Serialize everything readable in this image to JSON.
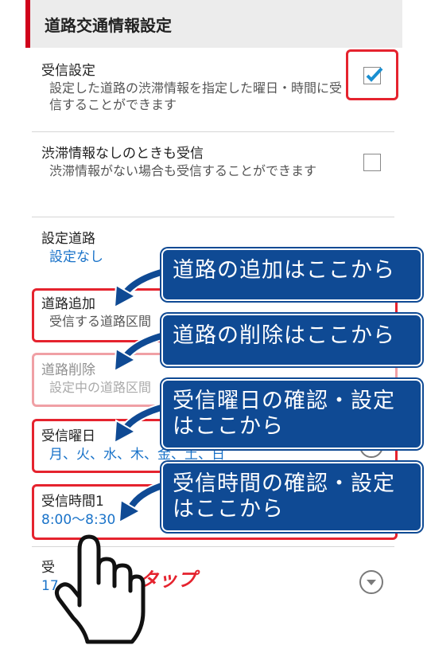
{
  "header": {
    "title": "道路交通情報設定"
  },
  "settings": {
    "receive": {
      "title": "受信設定",
      "desc": "設定した道路の渋滞情報を指定した曜日・時間に受信することができます",
      "checked": true
    },
    "no_traffic": {
      "title": "渋滞情報なしのときも受信",
      "desc": "渋滞情報がない場合も受信することができます",
      "checked": false
    },
    "roads": {
      "title": "設定道路",
      "value": "設定なし"
    },
    "add_road": {
      "title": "道路追加",
      "desc": "受信する道路区間"
    },
    "delete_road": {
      "title": "道路削除",
      "desc": "設定中の道路区間"
    },
    "days": {
      "title": "受信曜日",
      "value": "月、火、水、木、金、土、日"
    },
    "time1": {
      "title": "受信時間1",
      "value": "8:00～8:30"
    },
    "time2": {
      "title": "受",
      "value": "17"
    }
  },
  "callouts": {
    "add": "道路の追加はここから",
    "delete": "道路の削除はここから",
    "days": "受信曜日の確認・設定はここから",
    "time": "受信時間の確認・設定はここから"
  },
  "tap_label": "タップ",
  "colors": {
    "accent": "#d0021b",
    "highlight": "#e5232e",
    "callout_bg": "#0f4a94",
    "value_blue": "#1a73c9"
  }
}
